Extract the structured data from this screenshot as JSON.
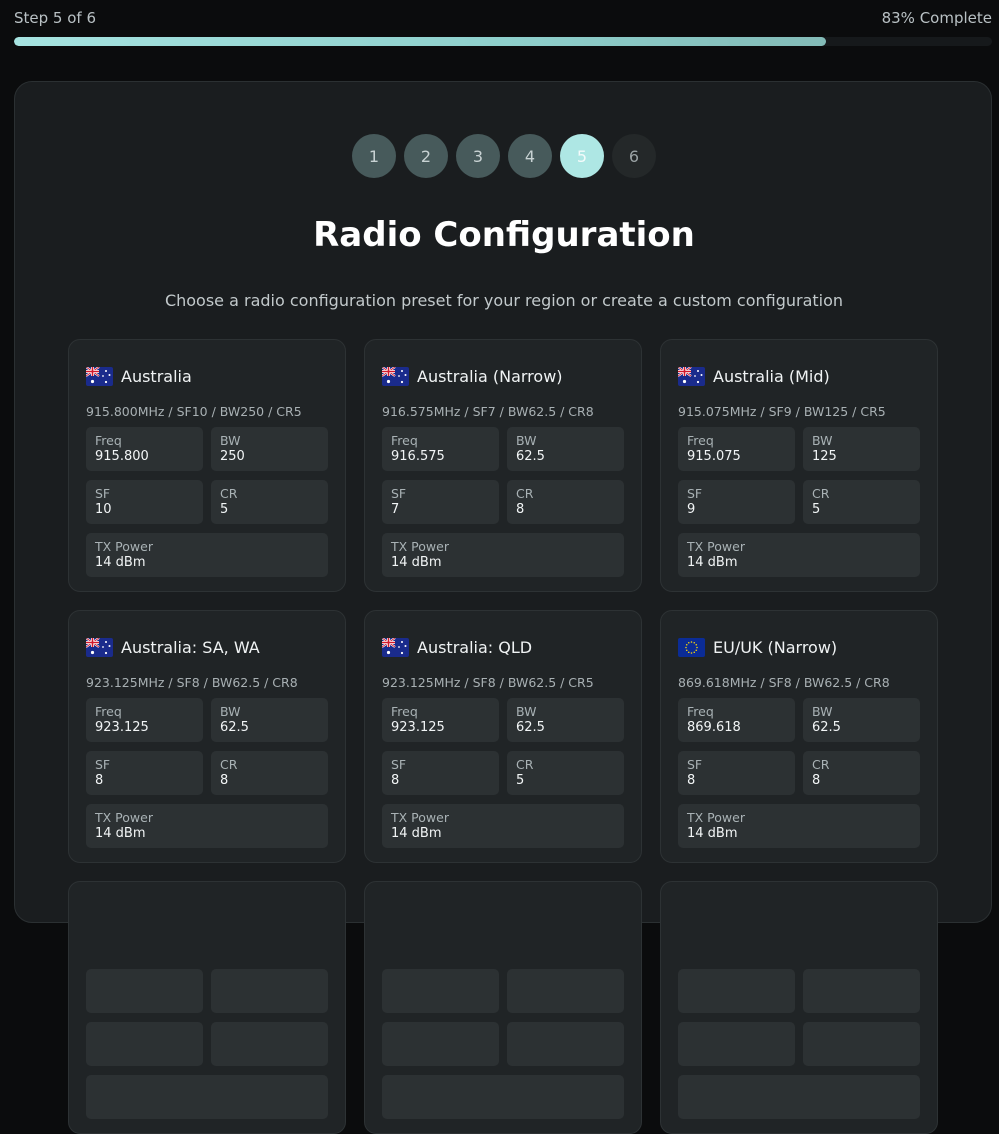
{
  "progress": {
    "step_text": "Step 5 of 6",
    "complete_text": "83% Complete",
    "percent": 83
  },
  "stepper": [
    {
      "label": "1",
      "state": "done"
    },
    {
      "label": "2",
      "state": "done"
    },
    {
      "label": "3",
      "state": "done"
    },
    {
      "label": "4",
      "state": "done"
    },
    {
      "label": "5",
      "state": "active"
    },
    {
      "label": "6",
      "state": "pending"
    }
  ],
  "page": {
    "title": "Radio Configuration",
    "subtitle": "Choose a radio configuration preset for your region or create a custom configuration"
  },
  "field_labels": {
    "freq": "Freq",
    "bw": "BW",
    "sf": "SF",
    "cr": "CR",
    "tx": "TX Power"
  },
  "presets": [
    {
      "flag": "au-flag-icon",
      "name": "Australia",
      "summary": "915.800MHz / SF10 / BW250 / CR5",
      "freq": "915.800",
      "bw": "250",
      "sf": "10",
      "cr": "5",
      "tx": "14 dBm"
    },
    {
      "flag": "au-flag-icon",
      "name": "Australia (Narrow)",
      "summary": "916.575MHz / SF7 / BW62.5 / CR8",
      "freq": "916.575",
      "bw": "62.5",
      "sf": "7",
      "cr": "8",
      "tx": "14 dBm"
    },
    {
      "flag": "au-flag-icon",
      "name": "Australia (Mid)",
      "summary": "915.075MHz / SF9 / BW125 / CR5",
      "freq": "915.075",
      "bw": "125",
      "sf": "9",
      "cr": "5",
      "tx": "14 dBm"
    },
    {
      "flag": "au-flag-icon",
      "name": "Australia: SA, WA",
      "summary": "923.125MHz / SF8 / BW62.5 / CR8",
      "freq": "923.125",
      "bw": "62.5",
      "sf": "8",
      "cr": "8",
      "tx": "14 dBm"
    },
    {
      "flag": "au-flag-icon",
      "name": "Australia: QLD",
      "summary": "923.125MHz / SF8 / BW62.5 / CR5",
      "freq": "923.125",
      "bw": "62.5",
      "sf": "8",
      "cr": "5",
      "tx": "14 dBm"
    },
    {
      "flag": "eu-flag-icon",
      "name": "EU/UK (Narrow)",
      "summary": "869.618MHz / SF8 / BW62.5 / CR8",
      "freq": "869.618",
      "bw": "62.5",
      "sf": "8",
      "cr": "8",
      "tx": "14 dBm"
    },
    {
      "flag": "",
      "name": "",
      "summary": "",
      "freq": "",
      "bw": "",
      "sf": "",
      "cr": "",
      "tx": ""
    },
    {
      "flag": "",
      "name": "",
      "summary": "",
      "freq": "",
      "bw": "",
      "sf": "",
      "cr": "",
      "tx": ""
    },
    {
      "flag": "",
      "name": "",
      "summary": "",
      "freq": "",
      "bw": "",
      "sf": "",
      "cr": "",
      "tx": ""
    }
  ],
  "colors": {
    "accent": "#aee7e4",
    "step_done": "#475a5b",
    "card_bg": "#202426",
    "field_bg": "#2c3133"
  }
}
